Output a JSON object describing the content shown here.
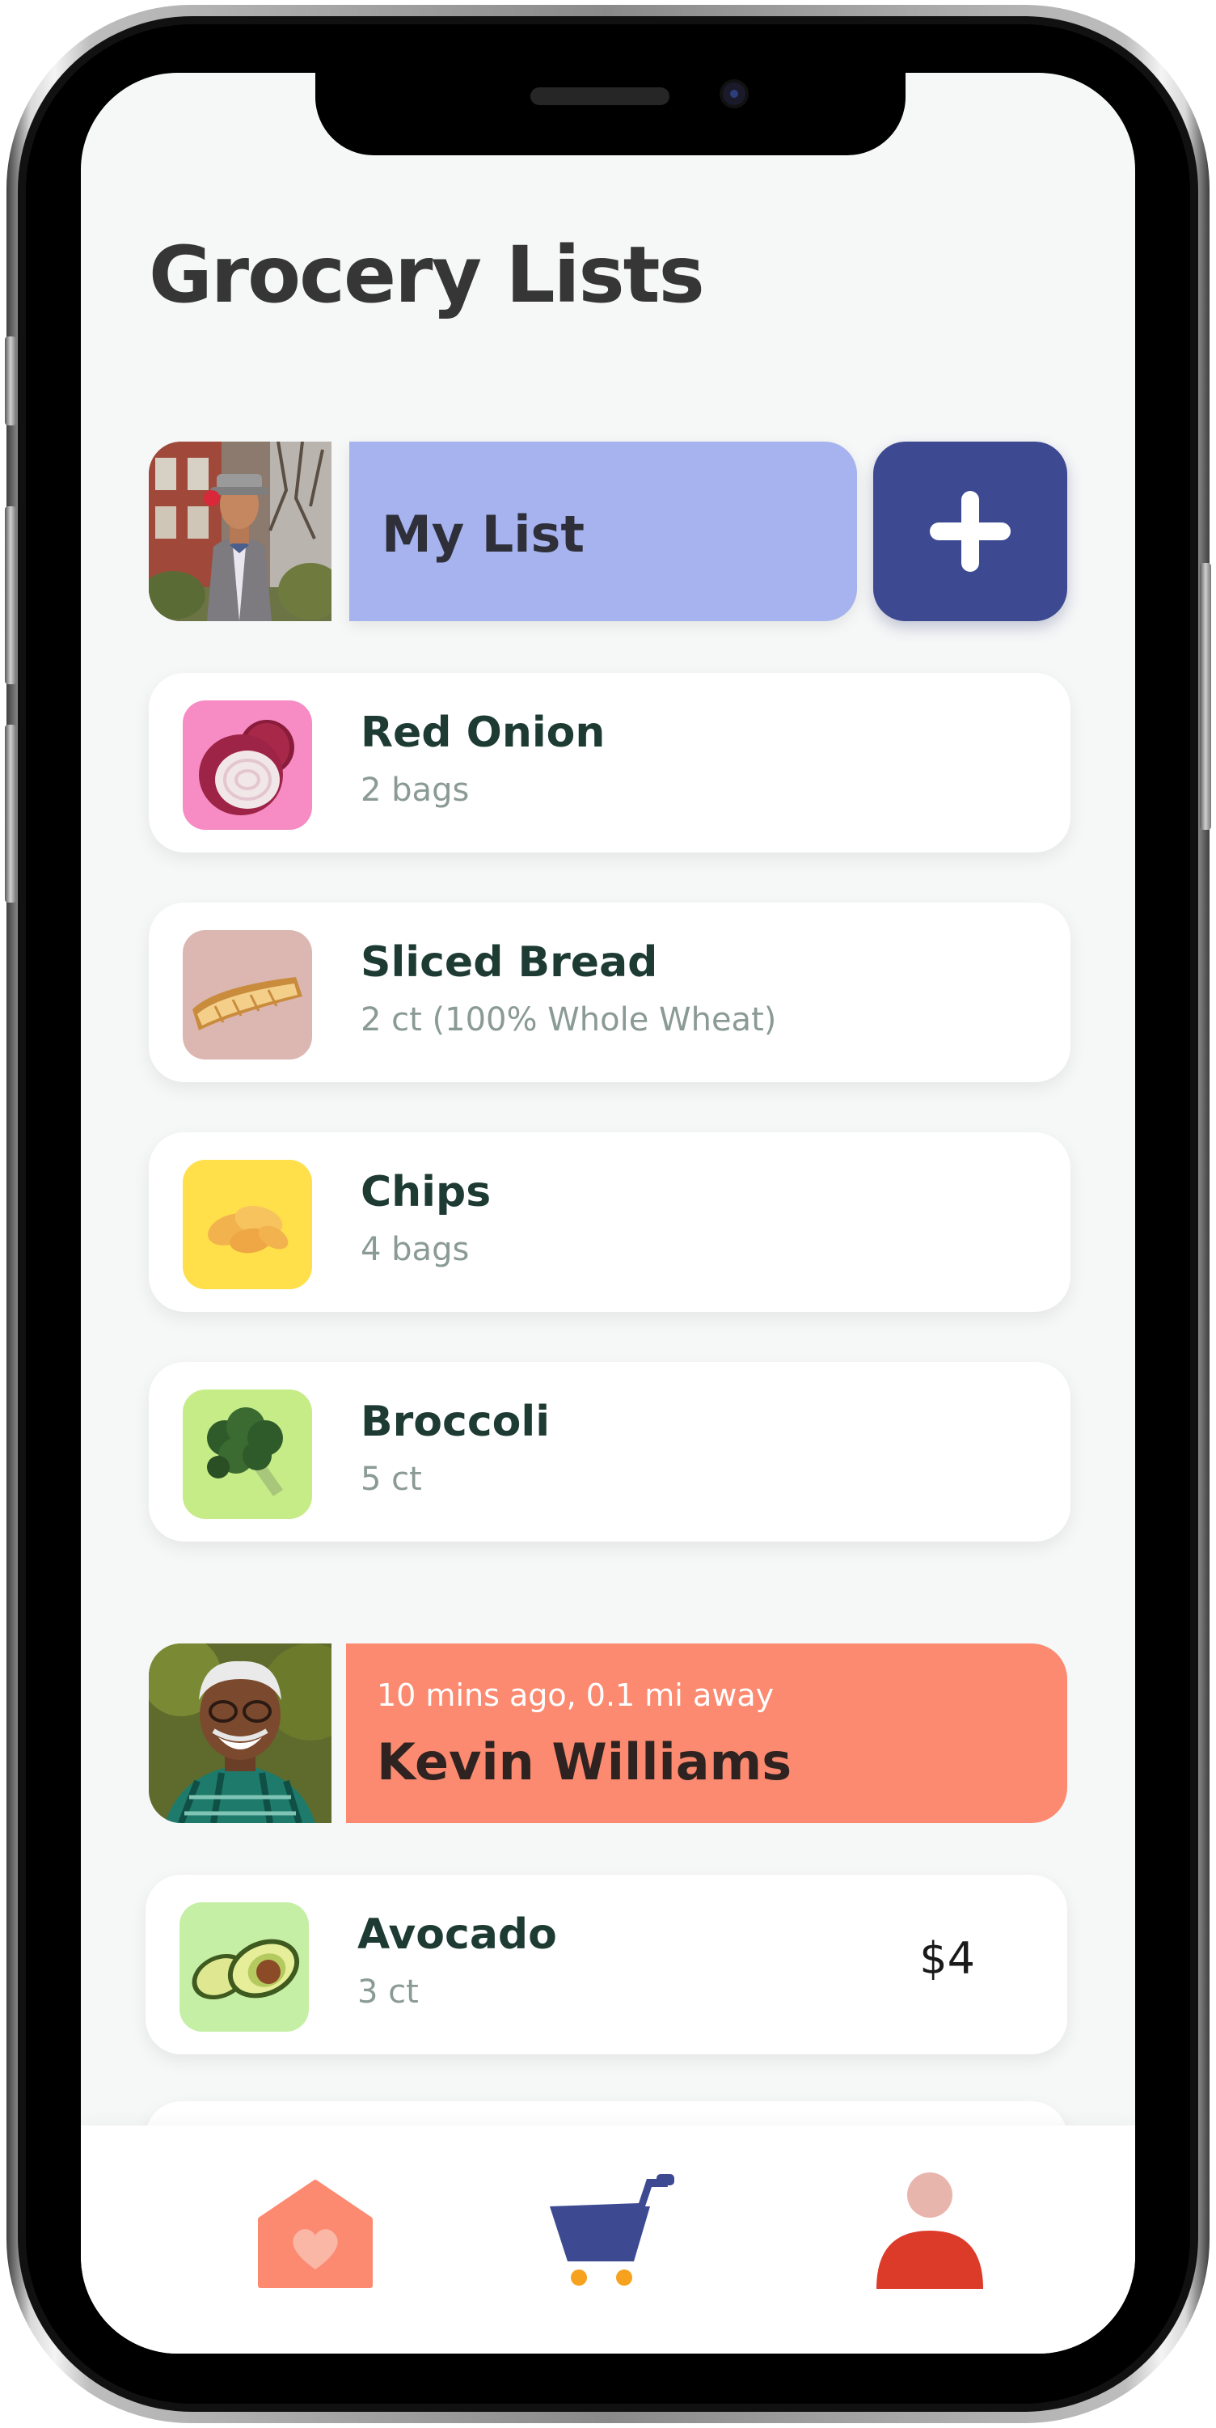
{
  "page": {
    "title": "Grocery Lists"
  },
  "my_list": {
    "title": "My List",
    "add_label": "+",
    "items": [
      {
        "name": "Red Onion",
        "detail": "2 bags",
        "thumb_color": "#f78bc4"
      },
      {
        "name": "Sliced Bread",
        "detail": "2 ct (100% Whole Wheat)",
        "thumb_color": "#dcb7b1"
      },
      {
        "name": "Chips",
        "detail": "4 bags",
        "thumb_color": "#ffdf4a"
      },
      {
        "name": "Broccoli",
        "detail": "5 ct",
        "thumb_color": "#c6ec88"
      }
    ]
  },
  "feed": {
    "meta": "10 mins ago, 0.1 mi away",
    "name": "Kevin Williams",
    "items": [
      {
        "name": "Avocado",
        "detail": "3 ct",
        "price": "$4",
        "thumb_color": "#c6efa6"
      }
    ]
  },
  "nav": {
    "items": [
      {
        "icon": "home-heart-icon",
        "color": "#fc8a71"
      },
      {
        "icon": "cart-icon",
        "color": "#3d4a92",
        "accent": "#f6a21e"
      },
      {
        "icon": "profile-icon",
        "color": "#dd3b2a",
        "accent": "#e8b5ad"
      }
    ]
  },
  "colors": {
    "list_header": "#a6b3ee",
    "add_button": "#3d4a92",
    "feed_header": "#fc8a71",
    "title_text": "#363636",
    "item_name": "#1d3b33",
    "item_detail": "#8a9a95"
  }
}
